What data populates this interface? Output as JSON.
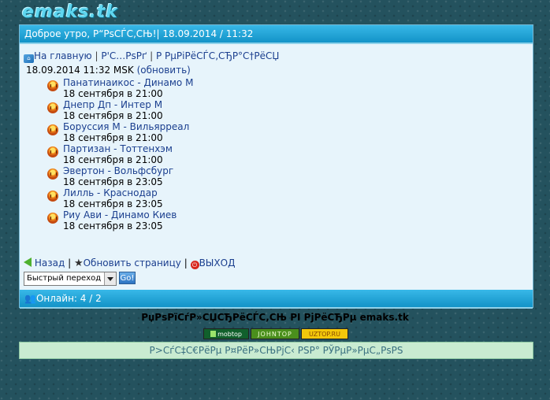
{
  "logo": "emaks.tk",
  "header": {
    "greeting": "Доброе утро, Р“РѕСЃС‚СЊ!| 18.09.2014 / 11:32"
  },
  "nav": {
    "home": "На главную",
    "link2": "Р'С…РѕРґ",
    "link3": "Р РµРіРёСЃС‚СЂР°С†РёСЏ",
    "separator": "|"
  },
  "datetime": {
    "text": "18.09.2014 11:32 MSK",
    "refresh": "(обновить)"
  },
  "matches": [
    {
      "name": "Панатинаикос - Динамо М",
      "time": "18 сентября в 21:00"
    },
    {
      "name": "Днепр Дп - Интер М",
      "time": "18 сентября в 21:00"
    },
    {
      "name": "Боруссия М - Вильярреал",
      "time": "18 сентября в 21:00"
    },
    {
      "name": "Партизан - Тоттенхэм",
      "time": "18 сентября в 21:00"
    },
    {
      "name": "Эвертон - Вольфсбург",
      "time": "18 сентября в 23:05"
    },
    {
      "name": "Лилль - Краснодар",
      "time": "18 сентября в 23:05"
    },
    {
      "name": "Риу Ави - Динамо Киев",
      "time": "18 сентября в 23:05"
    }
  ],
  "footer_links": {
    "back": "Назад",
    "refresh": "Обновить страницу",
    "exit": "ВЫХОД",
    "separator": "|"
  },
  "quick_jump": {
    "selected": "Быстрый переход",
    "go": "Go!"
  },
  "online": {
    "text": "Онлайн: 4 / 2"
  },
  "rating_title": "РџРѕРїСѓР»СЏСЂРёСЃС‚СЊ РІ РјРёСЂРµ emaks.tk",
  "counters": {
    "mobtop": "mobtop",
    "johntop": "JOHNTOP",
    "uztop": "UZTOP.RU"
  },
  "bottom_text": "Р>СѓС‡С€РёРµ Р¤РёР»СЊРјС‹ РЅР° РЎРµР»РµС„РѕРЅ"
}
